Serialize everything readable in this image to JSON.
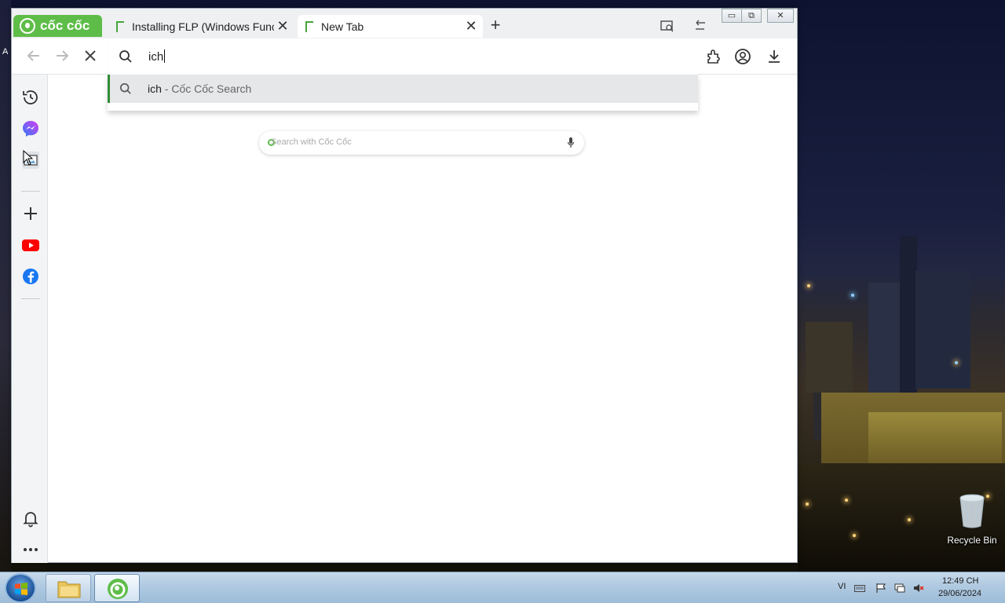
{
  "browser": {
    "brand": "cốc cốc",
    "tabs": [
      {
        "label": "Installing FLP (Windows Func",
        "close": "✕"
      },
      {
        "label": "New Tab",
        "close": "✕"
      }
    ],
    "new_tab_symbol": "+",
    "window_controls": {
      "minimize": "▭",
      "restore": "⧉",
      "close": "✕"
    },
    "address_bar": {
      "value": "ich"
    },
    "suggestions": [
      {
        "query": "ich",
        "description": " - Cốc Cốc Search"
      }
    ],
    "page": {
      "search_placeholder": "Search with Cốc Cốc"
    },
    "icons": {
      "back": "arrow-left-icon",
      "forward": "arrow-right-icon",
      "stop": "close-icon",
      "extensions": "puzzle-icon",
      "profile": "account-icon",
      "downloads": "download-icon"
    },
    "sidebar": [
      "history-icon",
      "messenger-icon",
      "screenshot-icon",
      "add-icon",
      "youtube-icon",
      "facebook-icon",
      "bell-icon",
      "more-icon"
    ]
  },
  "desktop": {
    "left_label": "A",
    "recycle_bin": "Recycle Bin"
  },
  "taskbar": {
    "language": "VI",
    "time": "12:49 CH",
    "date": "29/06/2024"
  },
  "colors": {
    "brand_green": "#5ebd48",
    "accent_green": "#2f8c35"
  }
}
